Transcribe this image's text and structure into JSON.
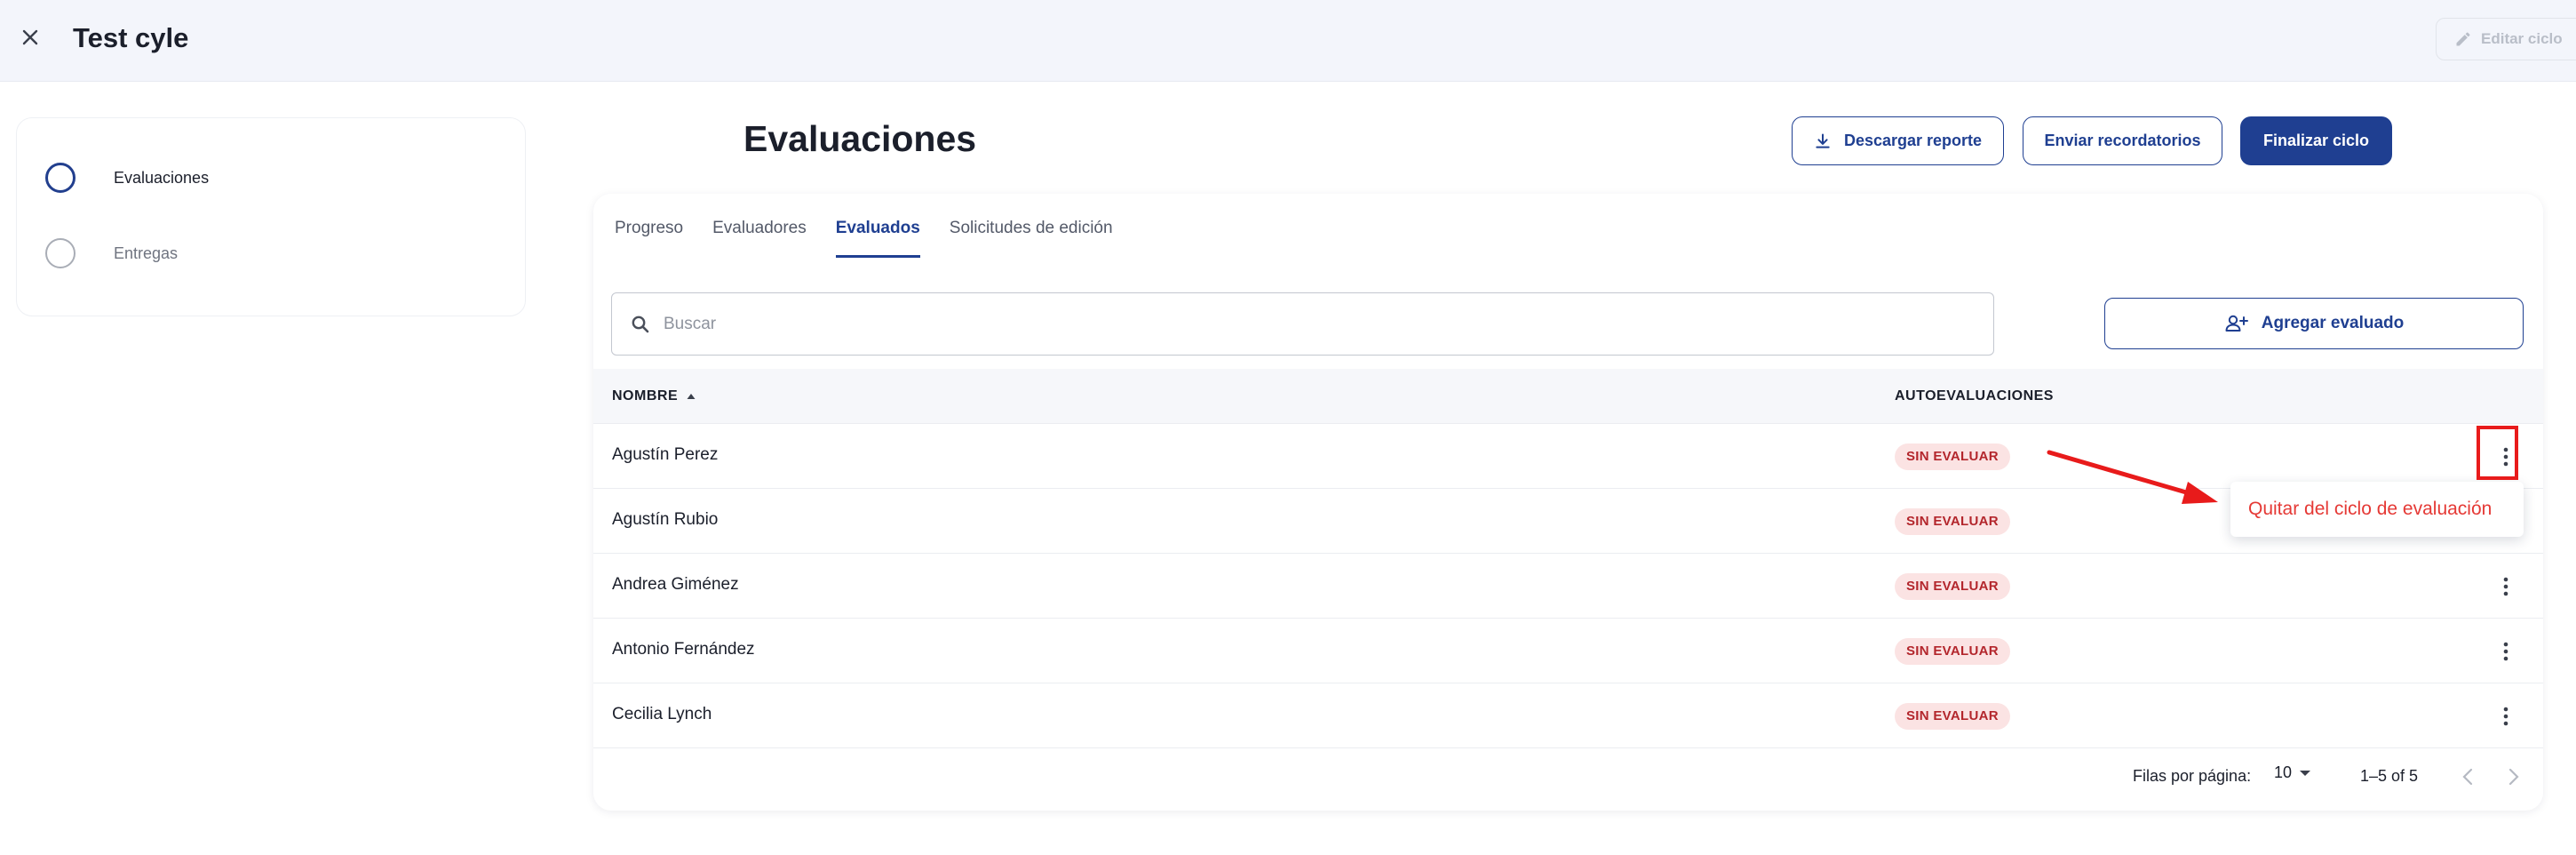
{
  "topbar": {
    "title": "Test cyle",
    "edit_label": "Editar ciclo"
  },
  "stepper": {
    "steps": [
      {
        "label": "Evaluaciones",
        "active": true
      },
      {
        "label": "Entregas",
        "active": false
      }
    ]
  },
  "header": {
    "title": "Evaluaciones",
    "download_label": "Descargar reporte",
    "remind_label": "Enviar recordatorios",
    "finish_label": "Finalizar ciclo"
  },
  "tabs": [
    {
      "label": "Progreso",
      "active": false
    },
    {
      "label": "Evaluadores",
      "active": false
    },
    {
      "label": "Evaluados",
      "active": true
    },
    {
      "label": "Solicitudes de edición",
      "active": false
    }
  ],
  "search": {
    "placeholder": "Buscar",
    "value": ""
  },
  "add_label": "Agregar evaluado",
  "table": {
    "columns": [
      "NOMBRE",
      "AUTOEVALUACIONES"
    ],
    "rows": [
      {
        "name": "Agustín Perez",
        "status": "SIN EVALUAR"
      },
      {
        "name": "Agustín Rubio",
        "status": "SIN EVALUAR"
      },
      {
        "name": "Andrea Giménez",
        "status": "SIN EVALUAR"
      },
      {
        "name": "Antonio Fernández",
        "status": "SIN EVALUAR"
      },
      {
        "name": "Cecilia Lynch",
        "status": "SIN EVALUAR"
      }
    ]
  },
  "row_menu": {
    "label": "Quitar del ciclo de evaluación"
  },
  "pagination": {
    "rows_per_page_label": "Filas por página:",
    "rows_per_page": "10",
    "range": "1–5 of 5"
  },
  "colors": {
    "primary": "#1f3f91",
    "danger": "#e53935",
    "badge_bg": "#fbe3e3",
    "badge_text": "#b3262c",
    "annotation": "#e81b1b"
  }
}
